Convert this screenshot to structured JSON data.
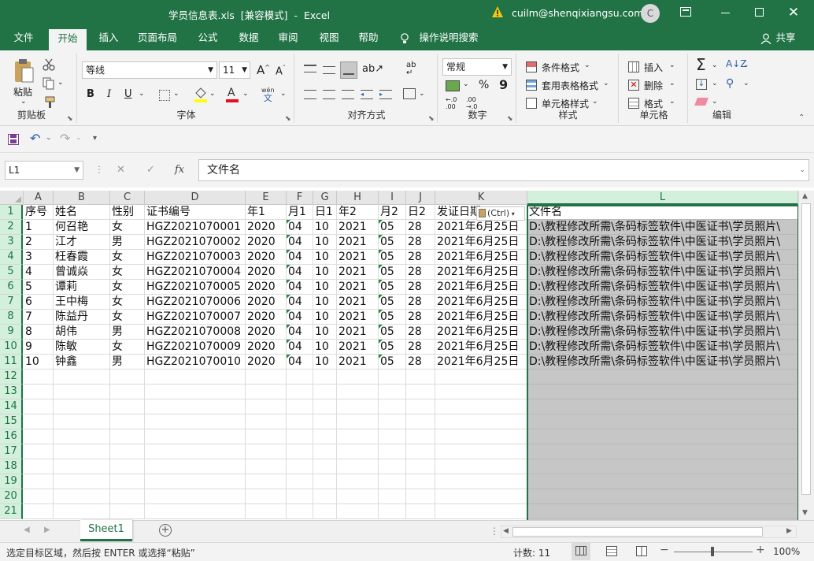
{
  "window": {
    "title": "学员信息表.xls  [兼容模式]  -  Excel",
    "warning_icon": "warning-triangle-icon",
    "account": "cuilm@shenqixiangsu.com",
    "avatar_letter": "C",
    "accent": "#217346"
  },
  "tabs": [
    "文件",
    "开始",
    "插入",
    "页面布局",
    "公式",
    "数据",
    "审阅",
    "视图",
    "帮助"
  ],
  "tell_me": "操作说明搜索",
  "share": "共享",
  "ribbon": {
    "clipboard": {
      "paste": "粘贴",
      "label": "剪贴板"
    },
    "font": {
      "name": "等线",
      "size": "11",
      "bold": "B",
      "italic": "I",
      "underline": "U",
      "label": "字体",
      "phonetic": "wén"
    },
    "alignment": {
      "label": "对齐方式"
    },
    "number": {
      "format": "常规",
      "label": "数字",
      "percent": "%",
      "comma": "9"
    },
    "styles": {
      "conditional": "条件格式",
      "table": "套用表格格式",
      "cell": "单元格样式",
      "label": "样式"
    },
    "cells": {
      "insert": "插入",
      "delete": "删除",
      "format": "格式",
      "label": "单元格"
    },
    "editing": {
      "label": "编辑"
    }
  },
  "formula_bar": {
    "name_box": "L1",
    "fx": "fx",
    "content": "文件名"
  },
  "columns": [
    "A",
    "B",
    "C",
    "D",
    "E",
    "F",
    "G",
    "H",
    "I",
    "J",
    "K",
    "L"
  ],
  "selected_column": "L",
  "row_numbers": [
    "1",
    "2",
    "3",
    "4",
    "5",
    "6",
    "7",
    "8",
    "9",
    "10",
    "11",
    "12",
    "13",
    "14",
    "15",
    "16",
    "17",
    "18",
    "19",
    "20",
    "21"
  ],
  "header_row": [
    "序号",
    "姓名",
    "性别",
    "证书编号",
    "年1",
    "月1",
    "日1",
    "年2",
    "月2",
    "日2",
    "发证日期",
    "文件名"
  ],
  "rows": [
    [
      "1",
      "何召艳",
      "女",
      "HGZ2021070001",
      "2020",
      "04",
      "10",
      "2021",
      "05",
      "28",
      "2021年6月25日",
      "D:\\教程修改所需\\条码标签软件\\中医证书\\学员照片\\"
    ],
    [
      "2",
      "江才",
      "男",
      "HGZ2021070002",
      "2020",
      "04",
      "10",
      "2021",
      "05",
      "28",
      "2021年6月25日",
      "D:\\教程修改所需\\条码标签软件\\中医证书\\学员照片\\"
    ],
    [
      "3",
      "枉春霞",
      "女",
      "HGZ2021070003",
      "2020",
      "04",
      "10",
      "2021",
      "05",
      "28",
      "2021年6月25日",
      "D:\\教程修改所需\\条码标签软件\\中医证书\\学员照片\\"
    ],
    [
      "4",
      "曾诚焱",
      "女",
      "HGZ2021070004",
      "2020",
      "04",
      "10",
      "2021",
      "05",
      "28",
      "2021年6月25日",
      "D:\\教程修改所需\\条码标签软件\\中医证书\\学员照片\\"
    ],
    [
      "5",
      "谭莉",
      "女",
      "HGZ2021070005",
      "2020",
      "04",
      "10",
      "2021",
      "05",
      "28",
      "2021年6月25日",
      "D:\\教程修改所需\\条码标签软件\\中医证书\\学员照片\\"
    ],
    [
      "6",
      "王中梅",
      "女",
      "HGZ2021070006",
      "2020",
      "04",
      "10",
      "2021",
      "05",
      "28",
      "2021年6月25日",
      "D:\\教程修改所需\\条码标签软件\\中医证书\\学员照片\\"
    ],
    [
      "7",
      "陈益丹",
      "女",
      "HGZ2021070007",
      "2020",
      "04",
      "10",
      "2021",
      "05",
      "28",
      "2021年6月25日",
      "D:\\教程修改所需\\条码标签软件\\中医证书\\学员照片\\"
    ],
    [
      "8",
      "胡伟",
      "男",
      "HGZ2021070008",
      "2020",
      "04",
      "10",
      "2021",
      "05",
      "28",
      "2021年6月25日",
      "D:\\教程修改所需\\条码标签软件\\中医证书\\学员照片\\"
    ],
    [
      "9",
      "陈敏",
      "女",
      "HGZ2021070009",
      "2020",
      "04",
      "10",
      "2021",
      "05",
      "28",
      "2021年6月25日",
      "D:\\教程修改所需\\条码标签软件\\中医证书\\学员照片\\"
    ],
    [
      "10",
      "钟鑫",
      "男",
      "HGZ2021070010",
      "2020",
      "04",
      "10",
      "2021",
      "05",
      "28",
      "2021年6月25日",
      "D:\\教程修改所需\\条码标签软件\\中医证书\\学员照片\\"
    ]
  ],
  "paste_options": "(Ctrl)",
  "sheet_tab": "Sheet1",
  "status": {
    "message": "选定目标区域，然后按 ENTER 或选择“粘贴”",
    "count": "计数: 11",
    "zoom": "100%"
  }
}
